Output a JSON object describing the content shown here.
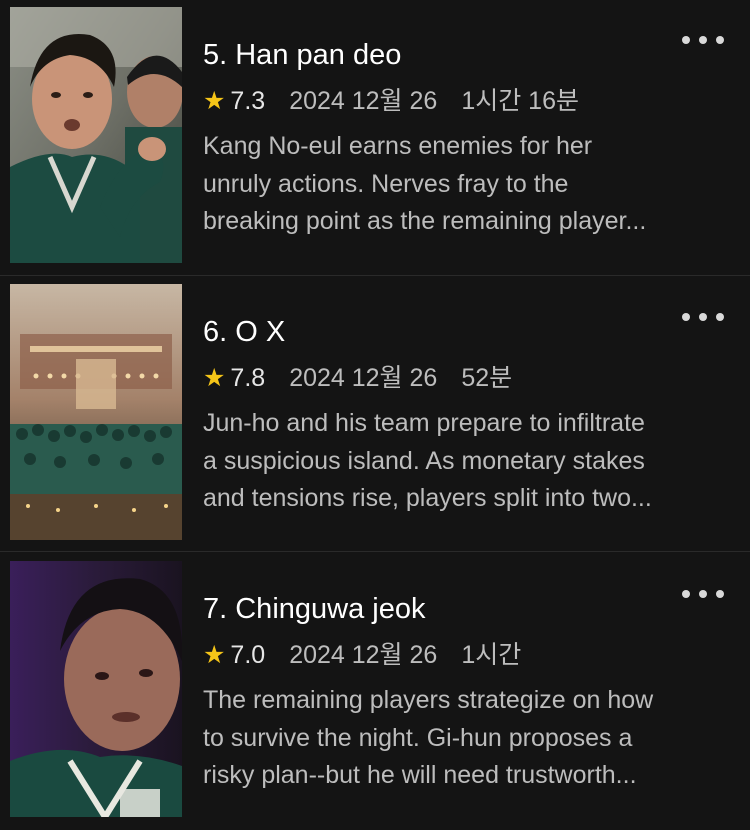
{
  "episodes": [
    {
      "title": "5. Han pan deo",
      "rating": "7.3",
      "air_date": "2024 12월 26",
      "runtime": "1시간 16분",
      "description_lines": [
        "Kang No-eul earns enemies for her",
        "unruly actions. Nerves fray to the",
        "breaking point as the remaining player..."
      ],
      "thumbnail_icon": "episode-5-thumbnail"
    },
    {
      "title": "6. O X",
      "rating": "7.8",
      "air_date": "2024 12월 26",
      "runtime": "52분",
      "description_lines": [
        "Jun-ho and his team prepare to infiltrate",
        "a suspicious island. As monetary stakes",
        "and tensions rise, players split into two..."
      ],
      "thumbnail_icon": "episode-6-thumbnail"
    },
    {
      "title": "7. Chinguwa jeok",
      "rating": "7.0",
      "air_date": "2024 12월 26",
      "runtime": "1시간",
      "description_lines": [
        "The remaining players strategize on how",
        "to survive the night. Gi-hun proposes a",
        "risky plan--but he will need trustworth..."
      ],
      "thumbnail_icon": "episode-7-thumbnail"
    }
  ],
  "icons": {
    "star": "star-icon",
    "more": "more-options-icon"
  },
  "colors": {
    "background": "#141414",
    "star": "#f5c518",
    "secondary_text": "#bdbdbd",
    "divider": "#2a2a2a"
  }
}
